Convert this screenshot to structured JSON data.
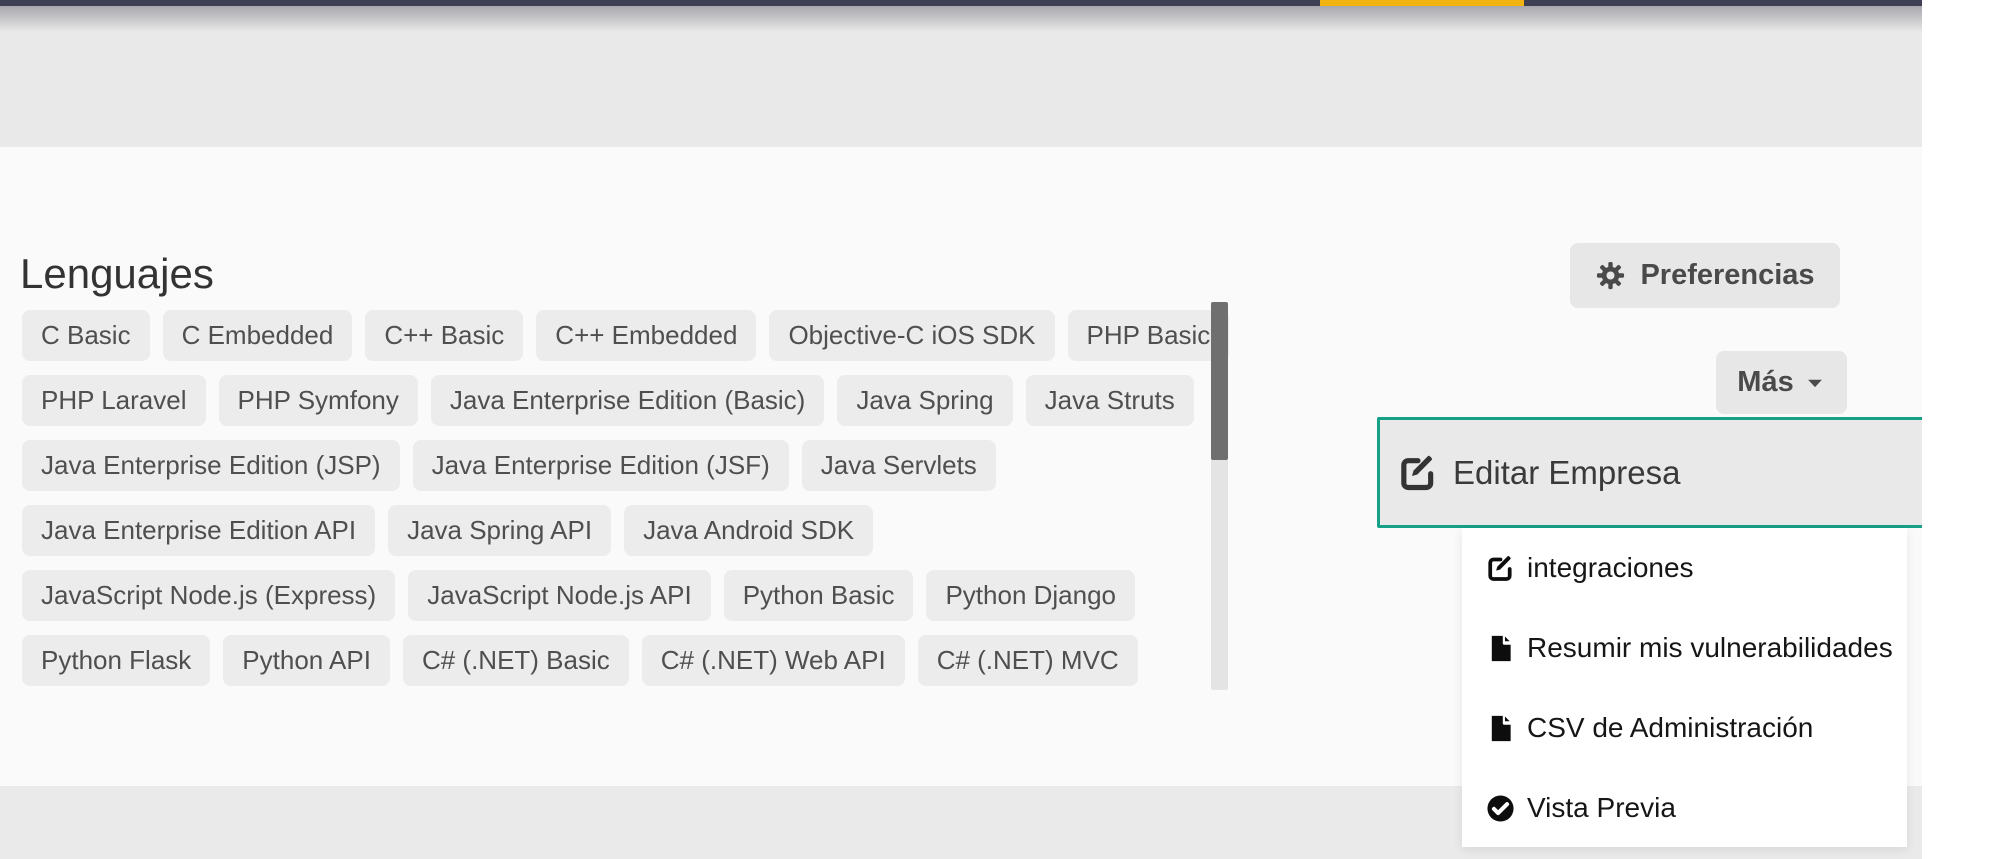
{
  "topbar": {
    "bar_color": "#3e3e55",
    "indicator_color": "#f0b30f"
  },
  "languages_section": {
    "heading": "Lenguajes",
    "chip_rows": [
      [
        "C Basic",
        "C Embedded",
        "C++ Basic",
        "C++ Embedded",
        "Objective-C iOS SDK",
        "PHP Basic"
      ],
      [
        "PHP Laravel",
        "PHP Symfony",
        "Java Enterprise Edition (Basic)",
        "Java Spring",
        "Java Struts"
      ],
      [
        "Java Enterprise Edition (JSP)",
        "Java Enterprise Edition (JSF)",
        "Java Servlets"
      ],
      [
        "Java Enterprise Edition API",
        "Java Spring API",
        "Java Android SDK"
      ],
      [
        "JavaScript Node.js (Express)",
        "JavaScript Node.js API",
        "Python Basic",
        "Python Django"
      ],
      [
        "Python Flask",
        "Python API",
        "C# (.NET) Basic",
        "C# (.NET) Web API",
        "C# (.NET) MVC"
      ]
    ]
  },
  "toolbar": {
    "preferences_label": "Preferencias",
    "preferences_icon": "gear-icon",
    "more_label": "Más",
    "more_icon": "caret-down-icon"
  },
  "more_menu": {
    "highlighted_item": {
      "label": "Editar Empresa",
      "icon": "edit-icon",
      "border_color": "#16a085"
    },
    "items": [
      {
        "label": "integraciones",
        "icon": "edit-icon"
      },
      {
        "label": "Resumir mis vulnerabilidades",
        "icon": "file-icon"
      },
      {
        "label": "CSV de Administración",
        "icon": "file-icon"
      },
      {
        "label": "Vista Previa",
        "icon": "check-circle-icon"
      }
    ]
  }
}
